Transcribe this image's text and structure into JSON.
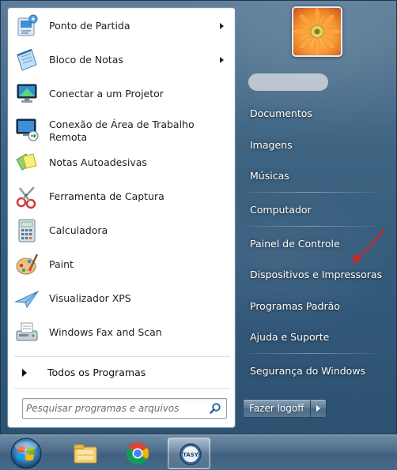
{
  "programs": [
    {
      "label": "Ponto de Partida",
      "icon": "getting-started-icon",
      "has_submenu": true
    },
    {
      "label": "Bloco de Notas",
      "icon": "notepad-icon",
      "has_submenu": true
    },
    {
      "label": "Conectar a um Projetor",
      "icon": "projector-icon",
      "has_submenu": false
    },
    {
      "label": "Conexão de Área de Trabalho Remota",
      "icon": "remote-desktop-icon",
      "has_submenu": false
    },
    {
      "label": "Notas Autoadesivas",
      "icon": "sticky-notes-icon",
      "has_submenu": false
    },
    {
      "label": "Ferramenta de Captura",
      "icon": "snipping-tool-icon",
      "has_submenu": false
    },
    {
      "label": "Calculadora",
      "icon": "calculator-icon",
      "has_submenu": false
    },
    {
      "label": "Paint",
      "icon": "paint-icon",
      "has_submenu": false
    },
    {
      "label": "Visualizador XPS",
      "icon": "xps-viewer-icon",
      "has_submenu": false
    },
    {
      "label": "Windows Fax and Scan",
      "icon": "fax-scan-icon",
      "has_submenu": false
    }
  ],
  "all_programs": {
    "label": "Todos os Programas"
  },
  "search": {
    "placeholder": "Pesquisar programas e arquivos"
  },
  "right_links": [
    {
      "label": "Documentos"
    },
    {
      "label": "Imagens"
    },
    {
      "label": "Músicas"
    },
    {
      "label": "Computador"
    },
    {
      "label": "Painel de Controle"
    },
    {
      "label": "Dispositivos e Impressoras"
    },
    {
      "label": "Programas Padrão"
    },
    {
      "label": "Ajuda e Suporte"
    },
    {
      "label": "Segurança do Windows"
    }
  ],
  "logoff": {
    "label": "Fazer logoff"
  },
  "taskbar": {
    "items": [
      {
        "name": "windows-explorer-icon"
      },
      {
        "name": "chrome-icon"
      },
      {
        "name": "tasy-icon",
        "label": "TASY",
        "active": true
      }
    ]
  },
  "colors": {
    "menu_glass": "#3e6482",
    "annotation_arrow": "#d62020",
    "taskbar": "#4d6d8b"
  }
}
